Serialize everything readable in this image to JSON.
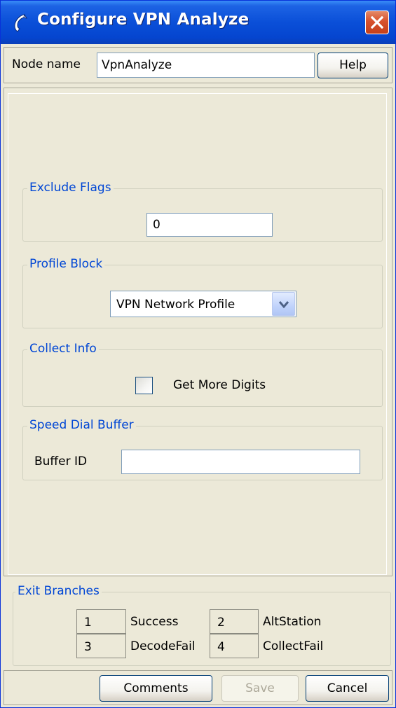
{
  "window": {
    "title": "Configure VPN Analyze",
    "icon": "phone-handset-icon",
    "close_icon": "close-icon",
    "colors": {
      "titlebar": "#0a4fd8",
      "background": "#ece9d8",
      "group_title": "#0046d5",
      "close": "#d7512c"
    }
  },
  "node": {
    "label": "Node name",
    "value": "VpnAnalyze",
    "help_label": "Help"
  },
  "exclude_flags": {
    "title": "Exclude Flags",
    "value": "0"
  },
  "profile_block": {
    "title": "Profile Block",
    "selected": "VPN Network Profile",
    "dropdown_icon": "chevron-down-icon"
  },
  "collect_info": {
    "title": "Collect Info",
    "checkbox_label": "Get More Digits",
    "checked": false
  },
  "speed_dial": {
    "title": "Speed Dial Buffer",
    "buffer_label": "Buffer ID",
    "buffer_value": ""
  },
  "exit_branches": {
    "title": "Exit Branches",
    "items": [
      {
        "number": "1",
        "name": "Success"
      },
      {
        "number": "2",
        "name": "AltStation"
      },
      {
        "number": "3",
        "name": "DecodeFail"
      },
      {
        "number": "4",
        "name": "CollectFail"
      }
    ]
  },
  "buttons": {
    "comments": "Comments",
    "save": "Save",
    "cancel": "Cancel"
  }
}
